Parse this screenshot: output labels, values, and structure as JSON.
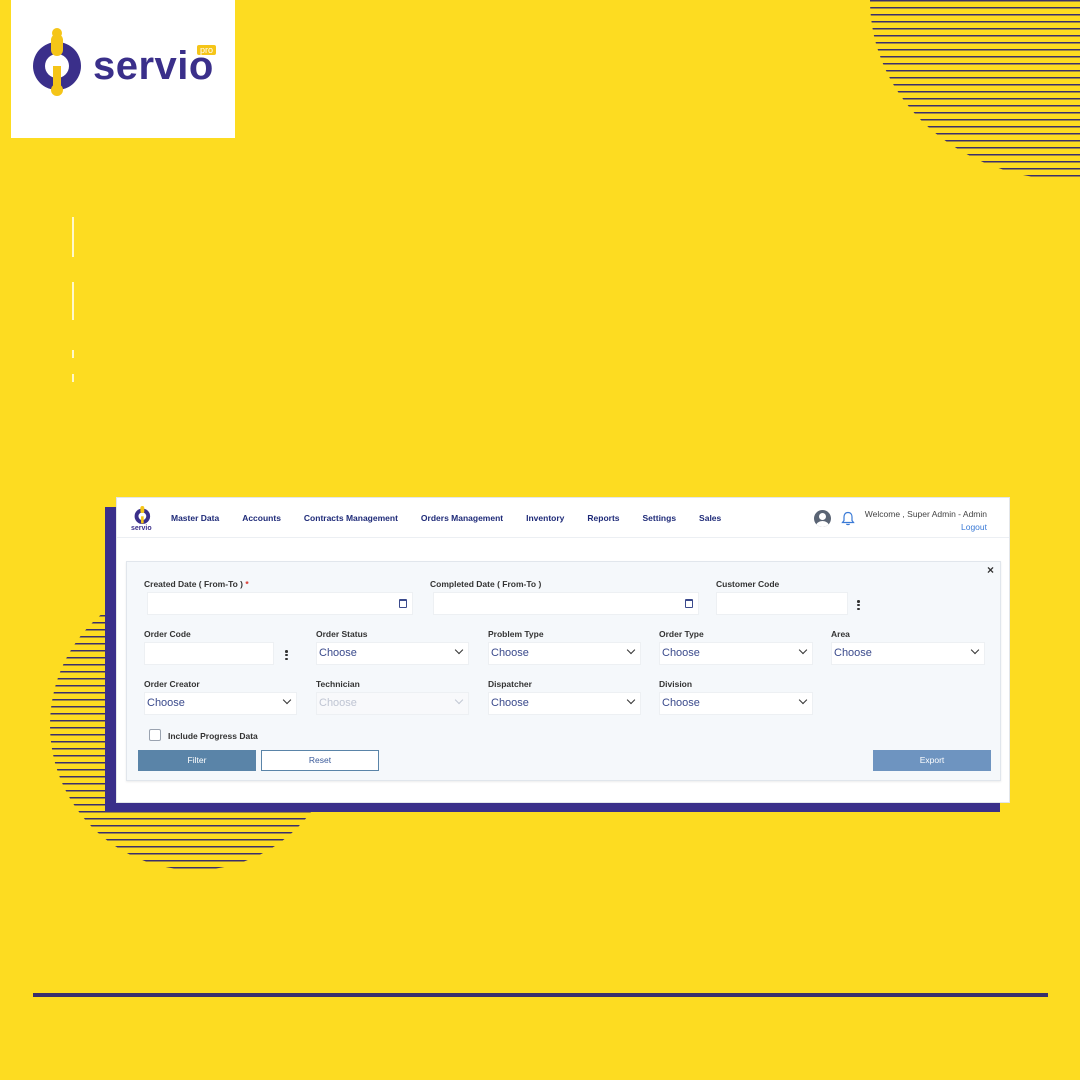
{
  "brand": {
    "name": "servio",
    "badge": "pro"
  },
  "nav": {
    "logo_text": "servio",
    "items": [
      "Master Data",
      "Accounts",
      "Contracts Management",
      "Orders Management",
      "Inventory",
      "Reports",
      "Settings",
      "Sales"
    ],
    "welcome": "Welcome , Super Admin - Admin",
    "logout": "Logout"
  },
  "filters": {
    "close": "×",
    "created_date": {
      "label": "Created Date ( From-To )",
      "required_mark": "*"
    },
    "completed_date": {
      "label": "Completed Date ( From-To )"
    },
    "customer_code": {
      "label": "Customer Code"
    },
    "order_code": {
      "label": "Order Code"
    },
    "order_status": {
      "label": "Order Status",
      "value": "Choose"
    },
    "problem_type": {
      "label": "Problem Type",
      "value": "Choose"
    },
    "order_type": {
      "label": "Order Type",
      "value": "Choose"
    },
    "area": {
      "label": "Area",
      "value": "Choose"
    },
    "order_creator": {
      "label": "Order Creator",
      "value": "Choose"
    },
    "technician": {
      "label": "Technician",
      "value": "Choose",
      "disabled": true
    },
    "dispatcher": {
      "label": "Dispatcher",
      "value": "Choose"
    },
    "division": {
      "label": "Division",
      "value": "Choose"
    },
    "include_progress": {
      "label": "Include Progress Data",
      "checked": false
    }
  },
  "buttons": {
    "filter": "Filter",
    "reset": "Reset",
    "export": "Export"
  },
  "colors": {
    "background": "#fddc21",
    "brand_purple": "#3a2f8a",
    "logo_yellow": "#f5c518",
    "filter_button": "#5a84a8",
    "export_button": "#6e94c0"
  }
}
